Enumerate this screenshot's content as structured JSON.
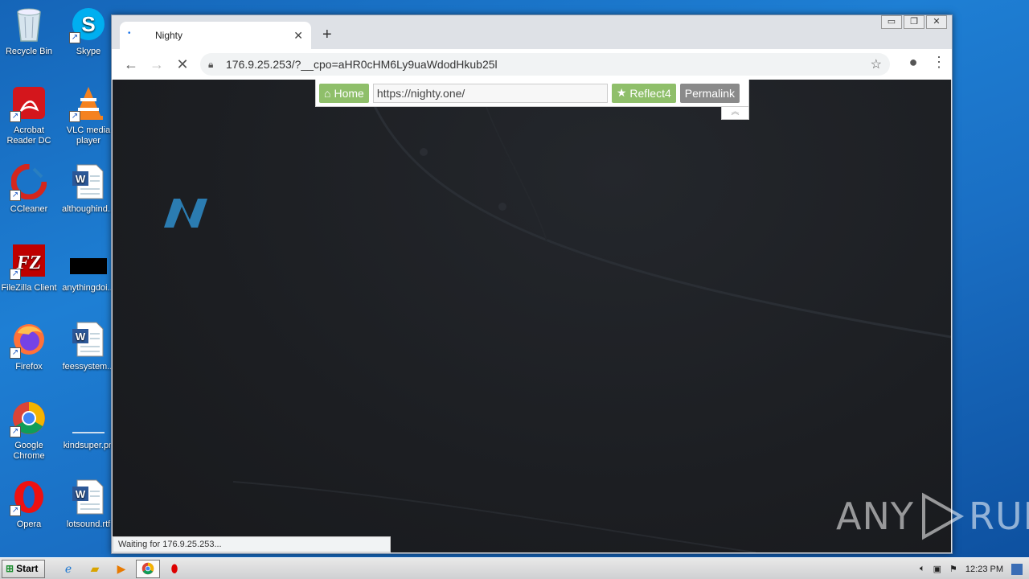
{
  "desktop": {
    "icons": [
      {
        "label": "Recycle Bin",
        "icon": "recycle-bin-icon"
      },
      {
        "label": "Skype",
        "icon": "skype-icon"
      },
      {
        "label": "Acrobat Reader DC",
        "icon": "acrobat-icon"
      },
      {
        "label": "VLC media player",
        "icon": "vlc-icon"
      },
      {
        "label": "CCleaner",
        "icon": "ccleaner-icon"
      },
      {
        "label": "althoughind...",
        "icon": "word-document-icon"
      },
      {
        "label": "FileZilla Client",
        "icon": "filezilla-icon"
      },
      {
        "label": "anythingdoi...",
        "icon": "black-file-icon"
      },
      {
        "label": "Firefox",
        "icon": "firefox-icon"
      },
      {
        "label": "feessystem...",
        "icon": "word-document-icon"
      },
      {
        "label": "Google Chrome",
        "icon": "chrome-icon"
      },
      {
        "label": "kindsuper.pn",
        "icon": "blank-file-icon"
      },
      {
        "label": "Opera",
        "icon": "opera-icon"
      },
      {
        "label": "lotsound.rtf",
        "icon": "word-document-icon"
      }
    ]
  },
  "browser": {
    "tab_title": "Nighty",
    "url": "176.9.25.253/?__cpo=aHR0cHM6Ly9uaWdodHkub25l",
    "status_text": "Waiting for 176.9.25.253..."
  },
  "proxy_bar": {
    "home_label": "Home",
    "url_value": "https://nighty.one/",
    "reflect_label": "Reflect4",
    "permalink_label": "Permalink"
  },
  "page": {
    "logo_letter": "N"
  },
  "watermark": {
    "text_left": "ANY",
    "text_right": "RUN"
  },
  "taskbar": {
    "start_label": "Start",
    "clock": "12:23 PM"
  },
  "colors": {
    "proxy_green": "#8fbf6a",
    "proxy_gray": "#8a8a8a",
    "page_bg": "#1c1e22",
    "logo_blue": "#2e86c1"
  }
}
